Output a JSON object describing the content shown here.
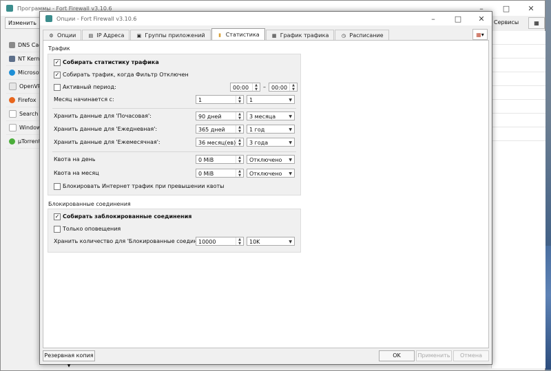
{
  "back_window": {
    "title": "Программы - Fort Firewall v3.10.6",
    "toolbar_left": "Изменить",
    "toolbar_right": "Сервисы",
    "apps": [
      "DNS Cach",
      "NT Kerne",
      "Microsoft",
      "OpenVPN",
      "Firefox",
      "Search ap",
      "Windows",
      "µTorrent"
    ]
  },
  "dialog": {
    "title": "Опции - Fort Firewall v3.10.6",
    "tabs": [
      "Опции",
      "IP Адреса",
      "Группы приложений",
      "Статистика",
      "График трафика",
      "Расписание"
    ],
    "active_tab": "Статистика",
    "traffic": {
      "group_title": "Трафик",
      "collect_stats": "Собирать статистику трафика",
      "collect_filter_off": "Собирать трафик, когда Фильтр Отключен",
      "active_period": "Активный период:",
      "period_from": "00:00",
      "period_dash": "–",
      "period_to": "00:00",
      "month_start_label": "Месяц начинается с:",
      "month_start_value": "1",
      "month_start_combo": "1",
      "keep_hourly_label": "Хранить данные для 'Почасовая':",
      "keep_hourly_value": "90 дней",
      "keep_hourly_combo": "3 месяца",
      "keep_daily_label": "Хранить данные для 'Ежедневная':",
      "keep_daily_value": "365 дней",
      "keep_daily_combo": "1 год",
      "keep_monthly_label": "Хранить данные для 'Ежемесячная':",
      "keep_monthly_value": "36 месяц(ев)",
      "keep_monthly_combo": "3 года",
      "quota_day_label": "Квота на день",
      "quota_day_value": "0 MiB",
      "quota_day_combo": "Отключено",
      "quota_month_label": "Квота на месяц",
      "quota_month_value": "0 MiB",
      "quota_month_combo": "Отключено",
      "block_on_quota": "Блокировать Интернет трафик при превышении квоты"
    },
    "blocked": {
      "group_title": "Блокированные соединения",
      "collect_blocked": "Собирать заблокированные соединения",
      "only_notify": "Только оповещения",
      "keep_count_label": "Хранить количество для 'Блокированные соединения':",
      "keep_count_value": "10000",
      "keep_count_combo": "10K"
    },
    "buttons": {
      "backup": "Резервная копия",
      "ok": "OK",
      "apply": "Применить",
      "cancel": "Отмена"
    }
  },
  "colors": {
    "accent": "#3b8d8d",
    "check": "#111111"
  }
}
